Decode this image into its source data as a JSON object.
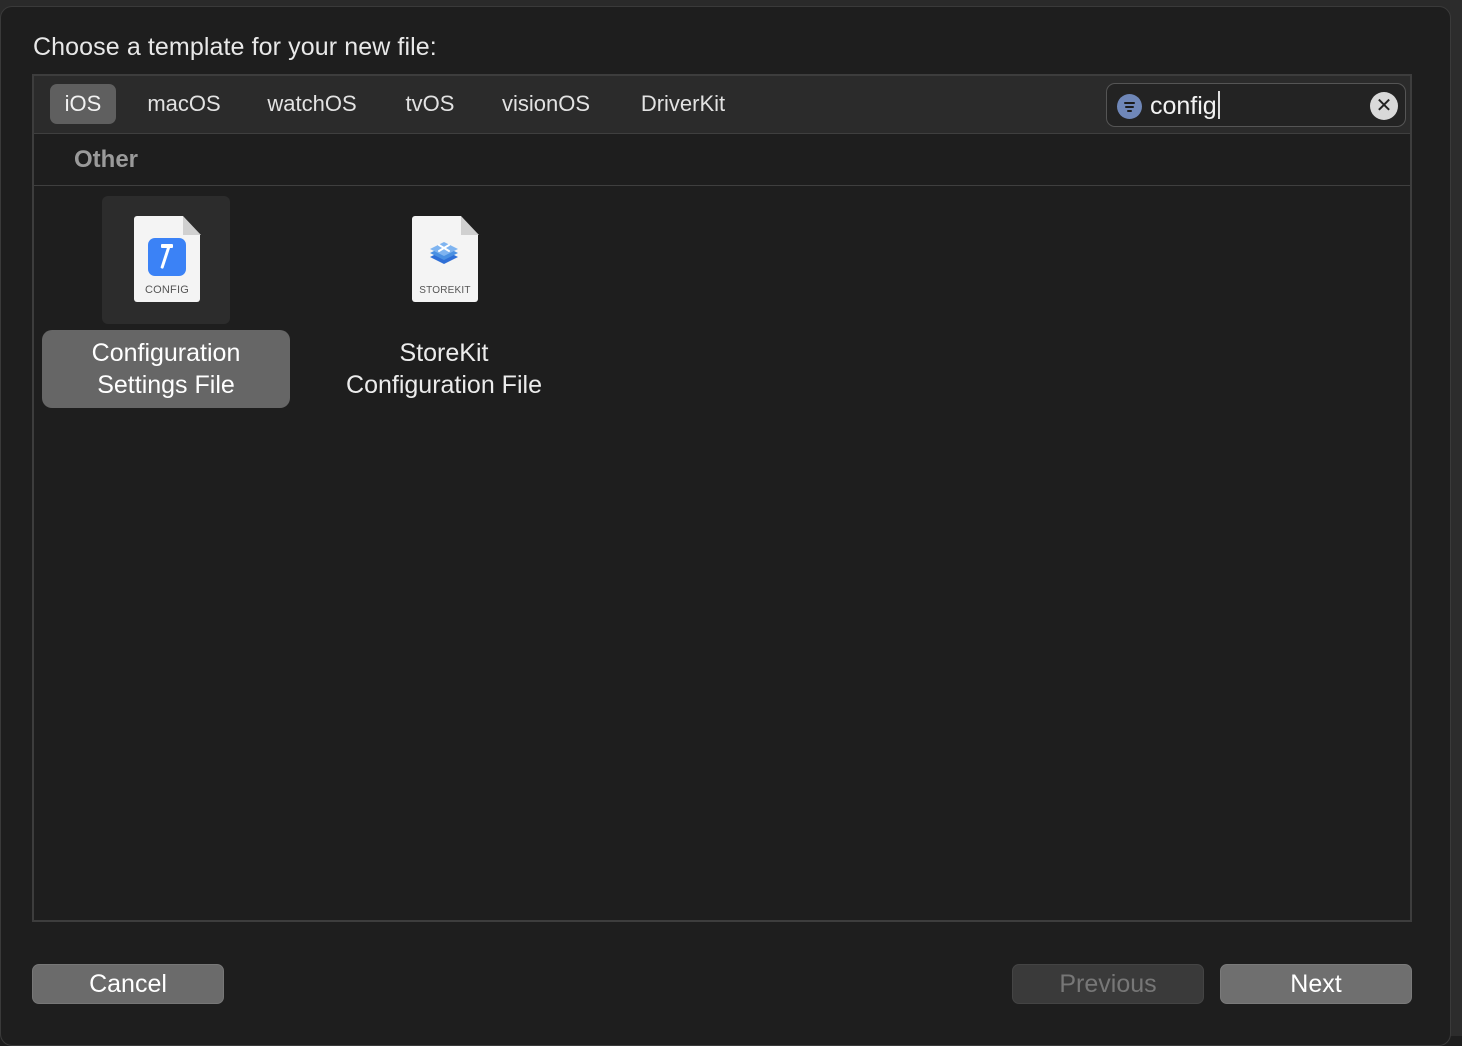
{
  "dialog": {
    "title": "Choose a template for your new file:"
  },
  "platform_tabs": [
    {
      "label": "iOS",
      "selected": true
    },
    {
      "label": "macOS",
      "selected": false
    },
    {
      "label": "watchOS",
      "selected": false
    },
    {
      "label": "tvOS",
      "selected": false
    },
    {
      "label": "visionOS",
      "selected": false
    },
    {
      "label": "DriverKit",
      "selected": false
    }
  ],
  "search": {
    "value": "config",
    "filter_icon": "filter-icon",
    "clear_icon": "clear-icon"
  },
  "section": {
    "label": "Other"
  },
  "templates": [
    {
      "icon": "config-file-icon",
      "badge": "CONFIG",
      "line1": "Configuration",
      "line2": "Settings File",
      "selected": true
    },
    {
      "icon": "storekit-file-icon",
      "badge": "STOREKIT",
      "line1": "StoreKit",
      "line2": "Configuration File",
      "selected": false
    }
  ],
  "buttons": {
    "cancel": "Cancel",
    "previous": "Previous",
    "next": "Next",
    "previous_enabled": false
  },
  "colors": {
    "selection": "#666666",
    "config_accent": "#3b82f6",
    "storekit_accent": "#4a90e2"
  }
}
